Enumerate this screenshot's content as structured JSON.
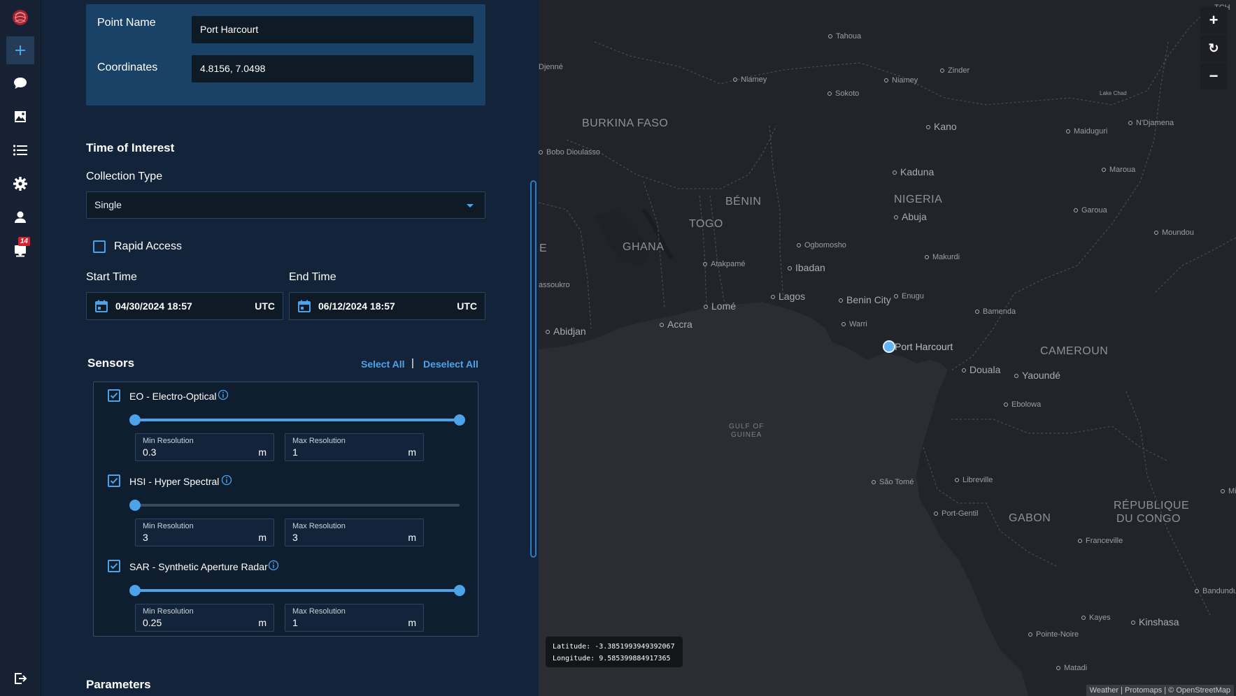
{
  "rail": {
    "badge": "14"
  },
  "point": {
    "name_label": "Point Name",
    "name_value": "Port Harcourt",
    "coords_label": "Coordinates",
    "coords_value": "4.8156, 7.0498"
  },
  "time": {
    "title": "Time of Interest",
    "collection_label": "Collection Type",
    "collection_value": "Single",
    "rapid_label": "Rapid Access",
    "rapid_checked": false,
    "start_label": "Start Time",
    "start_value": "04/30/2024 18:57",
    "end_label": "End Time",
    "end_value": "06/12/2024 18:57",
    "tz": "UTC"
  },
  "sensors": {
    "title": "Sensors",
    "select_all": "Select All",
    "separator": "|",
    "deselect_all": "Deselect All",
    "min_label": "Min Resolution",
    "max_label": "Max Resolution",
    "unit": "m",
    "items": [
      {
        "name": "EO - Electro-Optical",
        "checked": true,
        "min": "0.3",
        "max": "1",
        "range_low": 0.0,
        "range_high": 1.0
      },
      {
        "name": "HSI - Hyper Spectral",
        "checked": true,
        "min": "3",
        "max": "3",
        "range_low": 0.0,
        "range_high": 0.0
      },
      {
        "name": "SAR - Synthetic Aperture Radar",
        "checked": true,
        "min": "0.25",
        "max": "1",
        "range_low": 0.0,
        "range_high": 1.0
      }
    ]
  },
  "parameters": {
    "title": "Parameters"
  },
  "map": {
    "countries": [
      "BURKINA FASO",
      "BÉNIN",
      "TOGO",
      "GHANA",
      "NIGERIA",
      "CAMEROUN",
      "GABON",
      "RÉPUBLIQUE",
      "DU CONGO",
      "E"
    ],
    "sea": [
      "GULF OF",
      "GUINEA"
    ],
    "cities": {
      "tahoua": "Tahoua",
      "djenne": "Djenné",
      "niamey": "Niamey",
      "sokoto": "Sokoto",
      "niamey2": "Niamey",
      "zinder": "Zinder",
      "lake_chad": "Lake Chad",
      "kano": "Kano",
      "maiduguri": "Maiduguri",
      "ndjamena": "N'Djamena",
      "bobo": "Bobo Dioulasso",
      "kaduna": "Kaduna",
      "maroua": "Maroua",
      "abuja": "Abuja",
      "garoua": "Garoua",
      "moundou": "Moundou",
      "ogbomosho": "Ogbomosho",
      "makurdi": "Makurdi",
      "atakpame": "Atakpamé",
      "ibadan": "Ibadan",
      "yamoussoukro": "assoukro",
      "lagos": "Lagos",
      "benin_city": "Benin City",
      "enugu": "Enugu",
      "lome": "Lomé",
      "accra": "Accra",
      "bamenda": "Bamenda",
      "warri": "Warri",
      "abidjan": "Abidjan",
      "port_harcourt": "Port Harcourt",
      "douala": "Douala",
      "yaounde": "Yaoundé",
      "ebolowa": "Ebolowa",
      "sao_tome": "São Tomé",
      "libreville": "Libreville",
      "port_gentil": "Port-Gentil",
      "franceville": "Franceville",
      "bandundu": "Bandundu",
      "kayes": "Kayes",
      "kinshasa": "Kinshasa",
      "pointe_noire": "Pointe-Noire",
      "matadi": "Matadi",
      "tch": "TCH",
      "mi": "Mi"
    },
    "latitude": "Latitude: -3.3851993949392067",
    "longitude": "Longitude: 9.585399884917365",
    "attribution": "Weather | Protomaps | © OpenStreetMap",
    "zoom_in": "+",
    "reset": "↻",
    "zoom_out": "−"
  },
  "colors": {
    "accent": "#4da3ea",
    "panel_bg": "#13243a",
    "card_bg": "#1a4266",
    "map_bg": "#2c2d33",
    "land": "#25262b"
  }
}
